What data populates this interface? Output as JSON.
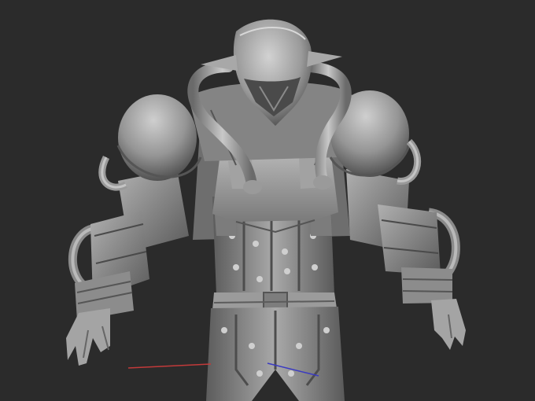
{
  "viewport": {
    "background": "#2b2b2b",
    "model_base_color": "#8f8f8f",
    "model_highlight": "#c4c4c4",
    "model_shadow": "#3c3c3c",
    "axis_colors": {
      "x": "#c23a3a",
      "z": "#3a3ac2"
    }
  }
}
